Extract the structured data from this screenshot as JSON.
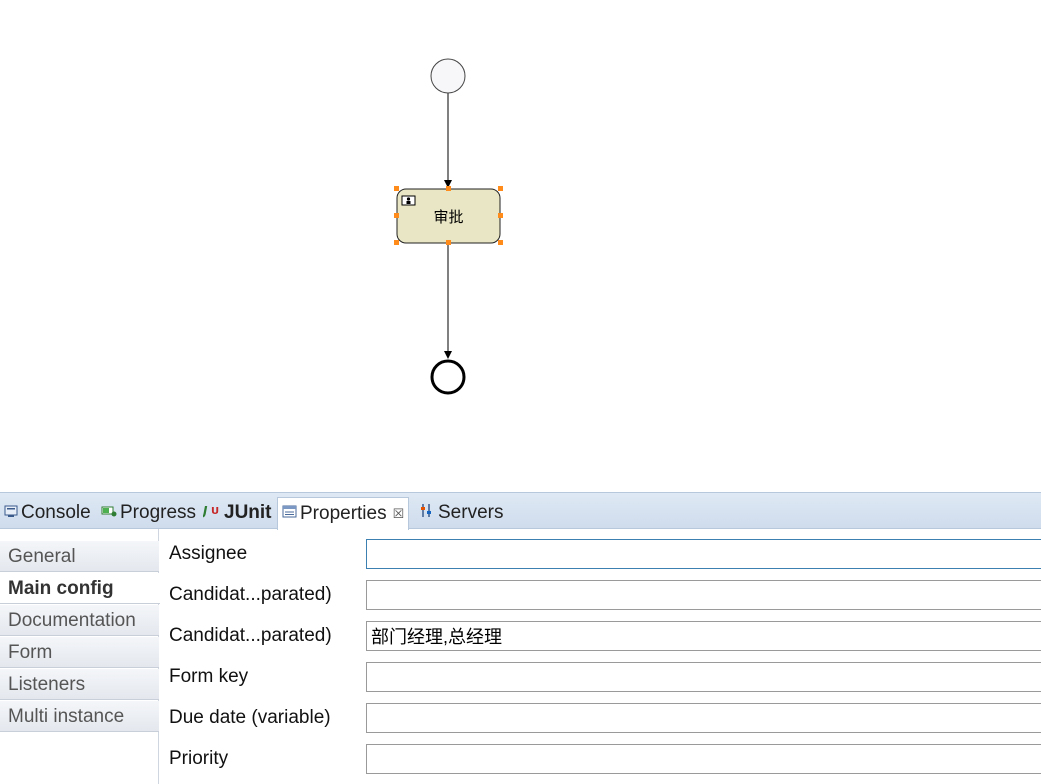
{
  "diagram": {
    "task_label": "审批",
    "start_event": "start",
    "end_event": "end"
  },
  "views": {
    "tabs": [
      {
        "label": "Console",
        "icon": "console-icon"
      },
      {
        "label": "Progress",
        "icon": "progress-icon"
      },
      {
        "label": "JUnit",
        "icon": "junit-icon"
      },
      {
        "label": "Properties",
        "icon": "properties-icon",
        "active": true
      },
      {
        "label": "Servers",
        "icon": "servers-icon"
      }
    ],
    "close_glyph": "☒"
  },
  "properties": {
    "side_tabs": [
      {
        "label": "General"
      },
      {
        "label": "Main config",
        "active": true
      },
      {
        "label": "Documentation"
      },
      {
        "label": "Form"
      },
      {
        "label": "Listeners"
      },
      {
        "label": "Multi instance"
      }
    ],
    "fields": [
      {
        "label": "Assignee",
        "value": ""
      },
      {
        "label": "Candidat...parated)",
        "value": ""
      },
      {
        "label": "Candidat...parated)",
        "value": "部门经理,总经理"
      },
      {
        "label": "Form key",
        "value": ""
      },
      {
        "label": "Due date (variable)",
        "value": ""
      },
      {
        "label": "Priority",
        "value": ""
      }
    ]
  },
  "colors": {
    "task_fill": "#e8e6c4",
    "selection_handle": "#ff8c1a",
    "focus_border": "#3c7fb1"
  }
}
